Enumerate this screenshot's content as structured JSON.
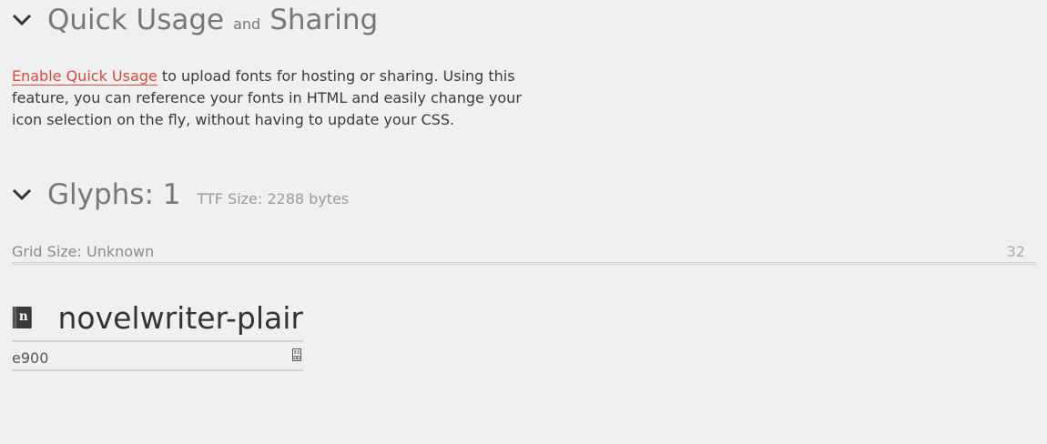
{
  "quick_usage": {
    "title_part1": "Quick Usage",
    "title_and": "and",
    "title_part2": "Sharing",
    "link_text": "Enable Quick Usage",
    "description": " to upload fonts for hosting or sharing. Using this feature, you can reference your fonts in HTML and easily change your icon selection on the fly, without having to update your CSS."
  },
  "glyphs": {
    "title": "Glyphs: 1",
    "ttf_size": "TTF Size: 2288 bytes",
    "grid_size_label": "Grid Size: Unknown",
    "grid_size_value": "32",
    "items": [
      {
        "name": "novelwriter-plair",
        "code": "e900",
        "icon": "novelwriter-book-icon"
      }
    ]
  },
  "colors": {
    "link": "#d9493a",
    "background": "#f0f0f0"
  }
}
